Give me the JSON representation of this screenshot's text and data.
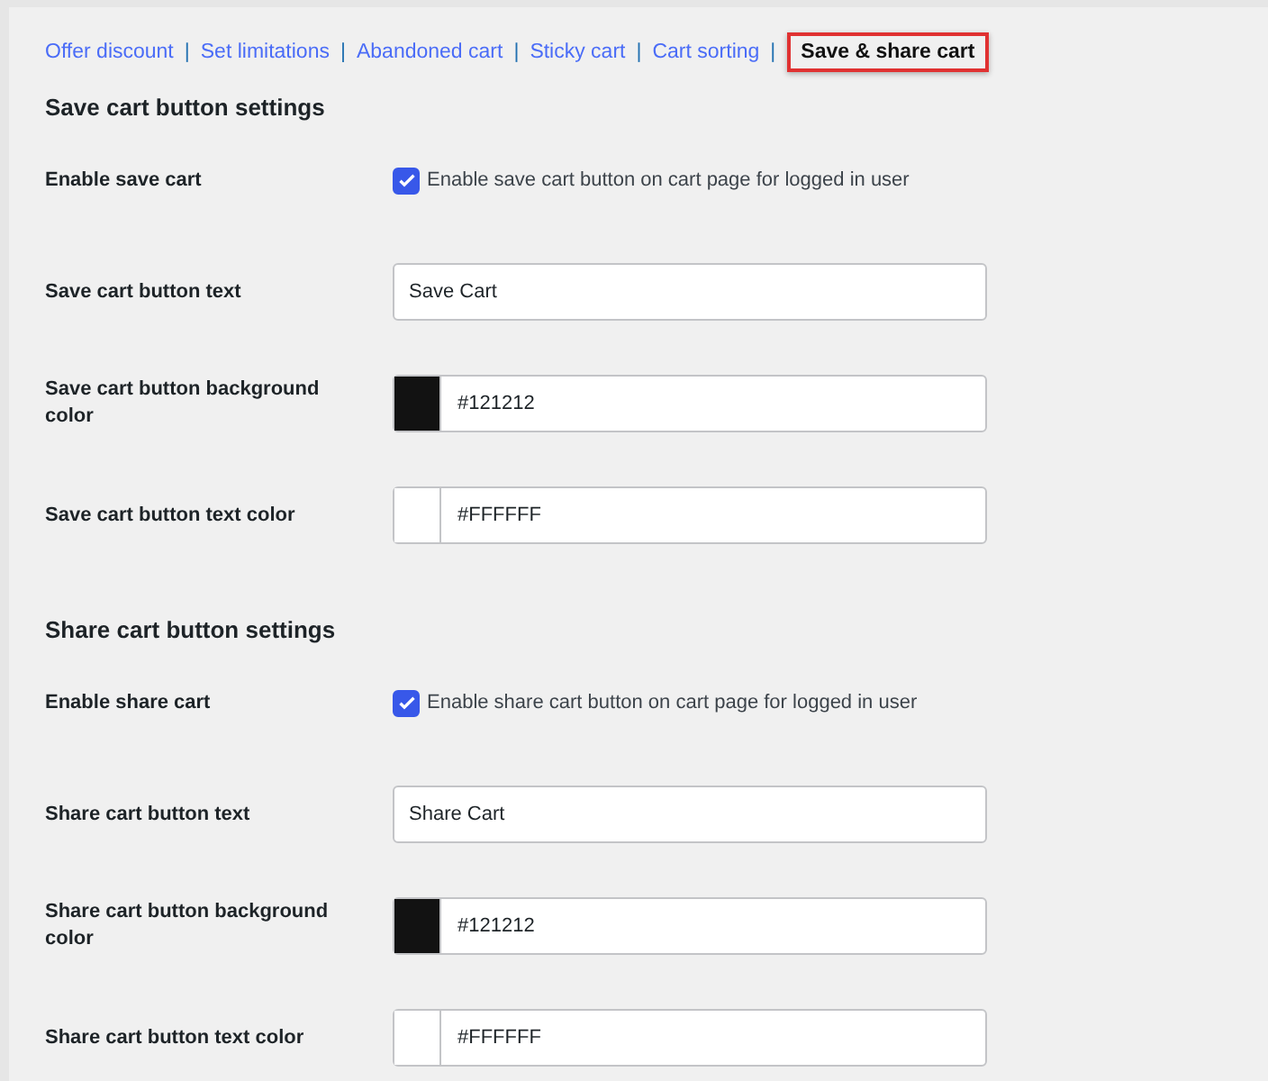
{
  "nav": [
    {
      "label": "Offer discount",
      "selected": false
    },
    {
      "label": "Set limitations",
      "separator": "|",
      "selected": false
    },
    {
      "label": "Abandoned cart",
      "separator": "|",
      "selected": false
    },
    {
      "label": "Sticky cart",
      "separator": "|",
      "selected": false
    },
    {
      "label": "Cart sorting",
      "separator": "|",
      "selected": false
    },
    {
      "label": "Save & share cart",
      "separator": "|",
      "selected": true
    }
  ],
  "sections": [
    {
      "title": "Save cart button settings",
      "rows": [
        {
          "kind": "checkbox",
          "label": "Enable save cart",
          "text": "Enable save cart button on cart page for logged in user",
          "checked": true
        },
        {
          "kind": "text",
          "label": "Save cart button text",
          "value": "Save Cart"
        },
        {
          "kind": "color",
          "label": "Save cart button background color",
          "value": "#121212"
        },
        {
          "kind": "color",
          "label": "Save cart button text color",
          "value": "#FFFFFF"
        }
      ]
    },
    {
      "title": "Share cart button settings",
      "rows": [
        {
          "kind": "checkbox",
          "label": "Enable share cart",
          "text": "Enable share cart button on cart page for logged in user",
          "checked": true
        },
        {
          "kind": "text",
          "label": "Share cart button text",
          "value": "Share Cart"
        },
        {
          "kind": "color",
          "label": "Share cart button background color",
          "value": "#121212"
        },
        {
          "kind": "color",
          "label": "Share cart button text color",
          "value": "#FFFFFF"
        }
      ]
    }
  ]
}
